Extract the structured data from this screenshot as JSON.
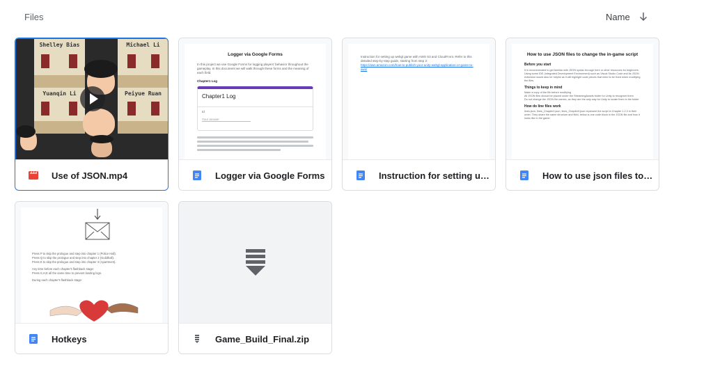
{
  "header": {
    "title": "Files",
    "sort_label": "Name"
  },
  "files": [
    {
      "name": "Use of JSON.mp4",
      "type": "video",
      "icon": "video-file-icon",
      "selected": true,
      "thumb": {
        "tiles": [
          "Shelley Bias",
          "Michael Li",
          "Yuanqin Li",
          "Peiyue Ruan"
        ]
      }
    },
    {
      "name": "Logger via Google Forms",
      "type": "doc",
      "icon": "google-docs-icon",
      "thumb": {
        "title": "Logger via Google Forms",
        "intro": "In this project we use Google Forms for logging players' behavior throughout the gameplay. In this document we will walk through these forms and the meaning of each field.",
        "section": "Chapter1 Log",
        "form_title": "Chapter1 Log",
        "form_field": "Id",
        "form_field_hint": "Your answer"
      }
    },
    {
      "name": "Instruction for setting up w...",
      "type": "doc",
      "icon": "google-docs-icon",
      "thumb": {
        "text": "Instruction for setting up webgl game with AWS S3 and CloudFront. Refer to this detailed step-by-step guide, starting from step 2:",
        "link": "https://aws.amazon.com/how-to-publish-your-unity-webgl-application-or-game-to-aws/"
      }
    },
    {
      "name": "How to use json files to ch...",
      "type": "doc",
      "icon": "google-docs-icon",
      "thumb": {
        "title": "How to use JSON files to change the in-game script",
        "h1": "Before you start",
        "p1": "It is recommended to get familiar with JSON syntax through here or other resources for beginners. Using some IDE (Integrated Development Environment) such as Visual Studio Code and its JSON extension would also be helpful as it will highlight code pieces that need to be fixed when modifying the files.",
        "h2": "Things to keep in mind",
        "bullets": [
          "Make a copy of the file before modifying",
          "All JSON files should be placed under the StreamingAssets folder for Unity to recognize them",
          "Do not change the JSON file names, as they are the only way for Unity to locate them in the folder"
        ],
        "h3": "How do line files work",
        "p2": "lines.json, lines_Chapter2.json, lines_Chapter3.json represent the script in Chapter 1,2,3 in their order. They share the same structure and field, below is one code block in the JSON file and how it looks like in the game:"
      }
    },
    {
      "name": "Hotkeys",
      "type": "doc",
      "icon": "google-docs-icon",
      "thumb": {
        "lines": [
          "Press P to skip the prologue and step into chapter 1 (Police Hall).",
          "Press Q to skip the prologue and step into chapter 2 (Guildhall).",
          "Press E to skip the prologue and step into chapter 3 (Apartment).",
          "Any time before each chapter's flashback stage:",
          "Press S,H,E all the same time to prevent landing logs.",
          "During each chapter's flashback stage:"
        ]
      }
    },
    {
      "name": "Game_Build_Final.zip",
      "type": "zip",
      "icon": "zip-file-icon"
    }
  ],
  "colors": {
    "accent": "#1a73e8",
    "docs_blue": "#4285f4",
    "video_red": "#ea4335",
    "border": "#dadce0"
  }
}
